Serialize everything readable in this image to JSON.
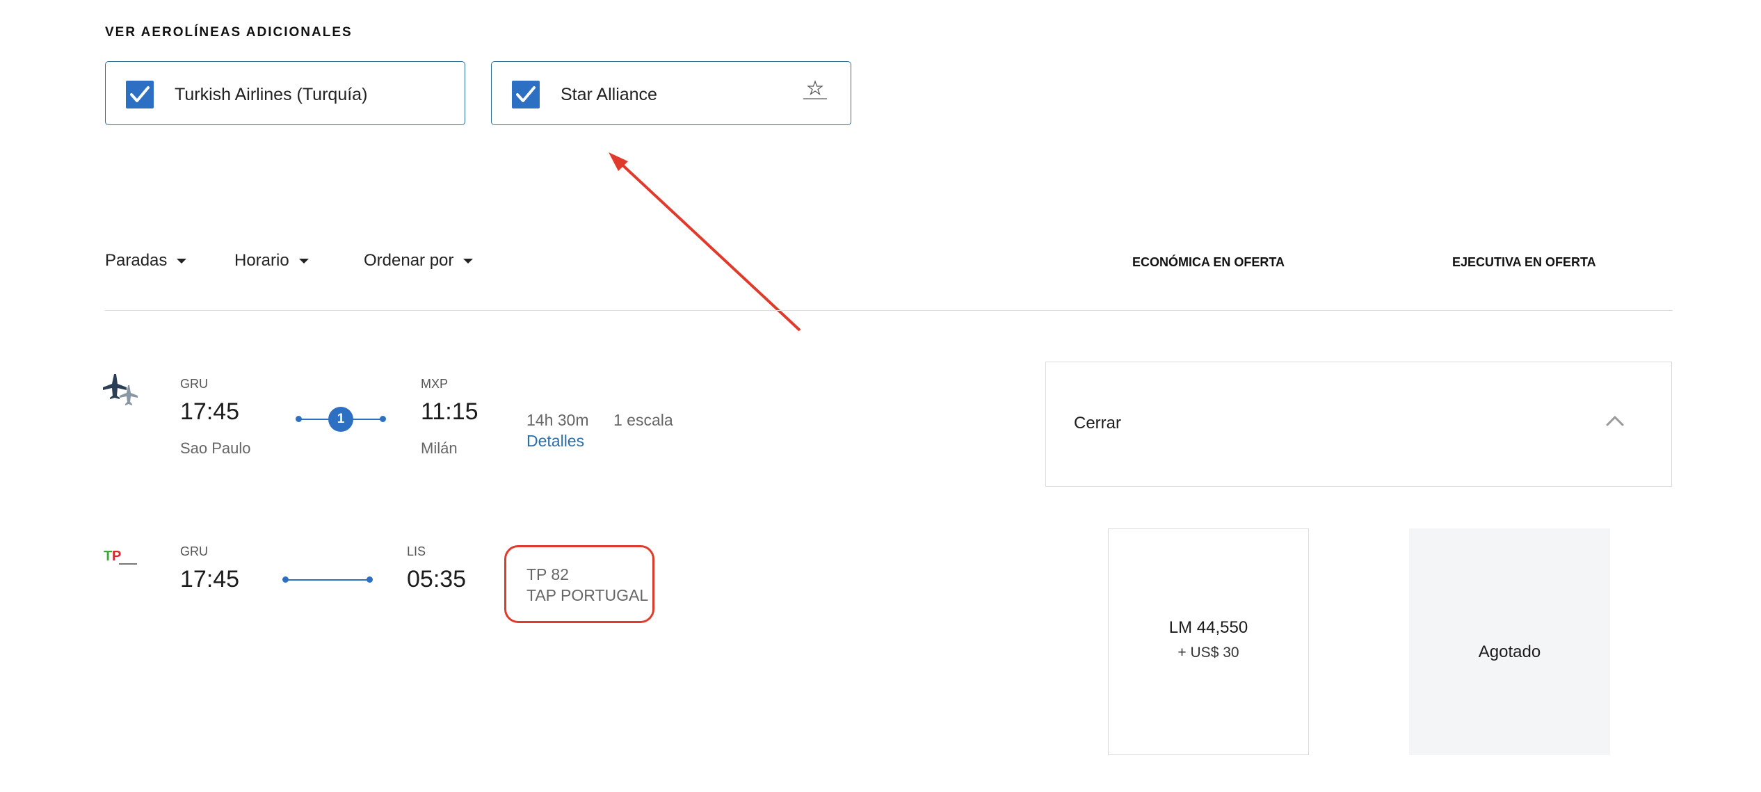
{
  "filters_section": {
    "title": "VER AEROLÍNEAS ADICIONALES",
    "airlines": [
      {
        "label": "Turkish Airlines (Turquía)",
        "checked": true
      },
      {
        "label": "Star Alliance",
        "checked": true,
        "logo_icon": "star-alliance-icon"
      }
    ]
  },
  "toolbar": {
    "stops_label": "Paradas",
    "schedule_label": "Horario",
    "sort_label": "Ordenar por",
    "economy_header": "ECONÓMICA EN OFERTA",
    "business_header": "EJECUTIVA EN OFERTA"
  },
  "flights": [
    {
      "airline_icon": "multi-airline-icon",
      "origin_code": "GRU",
      "departure_time": "17:45",
      "origin_city": "Sao Paulo",
      "stops_count": "1",
      "destination_code": "MXP",
      "arrival_time": "11:15",
      "destination_city": "Milán",
      "duration": "14h 30m",
      "stops_text": "1 escala",
      "details_link": "Detalles",
      "close_label": "Cerrar"
    },
    {
      "airline_icon": "tap-portugal-logo",
      "origin_code": "GRU",
      "departure_time": "17:45",
      "destination_code": "LIS",
      "arrival_time": "05:35",
      "flight_number": "TP 82",
      "airline_name": "TAP PORTUGAL",
      "economy_price": "LM 44,550",
      "economy_fee": "+ US$ 30",
      "business_status": "Agotado"
    }
  ],
  "colors": {
    "accent": "#2d6fc2",
    "annotation": "#e03a2c",
    "link": "#2b6ea8"
  }
}
